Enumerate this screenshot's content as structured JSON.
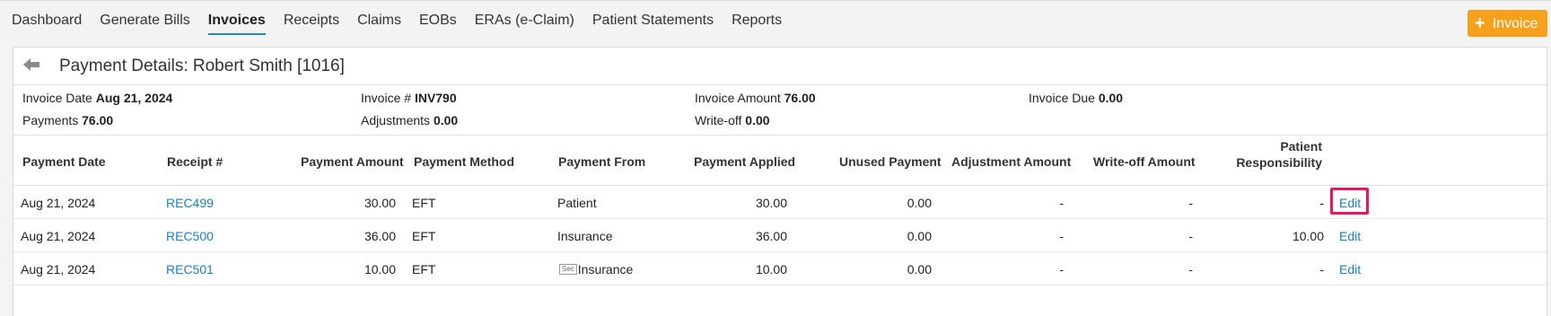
{
  "nav": {
    "items": [
      "Dashboard",
      "Generate Bills",
      "Invoices",
      "Receipts",
      "Claims",
      "EOBs",
      "ERAs (e-Claim)",
      "Patient Statements",
      "Reports"
    ],
    "active": "Invoices"
  },
  "add_invoice_button": {
    "label": "Invoice",
    "icon": "plus-icon",
    "color": "#f7a01c"
  },
  "page": {
    "title": "Payment Details: Robert Smith [1016]"
  },
  "summary": {
    "invoice_date_label": "Invoice Date",
    "invoice_date": "Aug 21, 2024",
    "invoice_no_label": "Invoice #",
    "invoice_no": "INV790",
    "invoice_amount_label": "Invoice Amount",
    "invoice_amount": "76.00",
    "invoice_due_label": "Invoice Due",
    "invoice_due": "0.00",
    "payments_label": "Payments",
    "payments": "76.00",
    "adjustments_label": "Adjustments",
    "adjustments": "0.00",
    "writeoff_label": "Write-off",
    "writeoff": "0.00"
  },
  "table": {
    "headers": {
      "payment_date": "Payment Date",
      "receipt_no": "Receipt #",
      "payment_amount": "Payment Amount",
      "payment_method": "Payment Method",
      "payment_from": "Payment From",
      "payment_applied": "Payment Applied",
      "unused_payment": "Unused Payment",
      "adjustment_amount": "Adjustment Amount",
      "writeoff_amount": "Write-off Amount",
      "patient_responsibility_1": "Patient",
      "patient_responsibility_2": "Responsibility"
    },
    "rows": [
      {
        "date": "Aug 21, 2024",
        "receipt": "REC499",
        "amount": "30.00",
        "method": "EFT",
        "from_badge": "",
        "from": "Patient",
        "applied": "30.00",
        "unused": "0.00",
        "adjustment": "-",
        "writeoff": "-",
        "responsibility": "-",
        "action": "Edit"
      },
      {
        "date": "Aug 21, 2024",
        "receipt": "REC500",
        "amount": "36.00",
        "method": "EFT",
        "from_badge": "",
        "from": "Insurance",
        "applied": "36.00",
        "unused": "0.00",
        "adjustment": "-",
        "writeoff": "-",
        "responsibility": "10.00",
        "action": "Edit"
      },
      {
        "date": "Aug 21, 2024",
        "receipt": "REC501",
        "amount": "10.00",
        "method": "EFT",
        "from_badge": "Sec",
        "from": "Insurance",
        "applied": "10.00",
        "unused": "0.00",
        "adjustment": "-",
        "writeoff": "-",
        "responsibility": "-",
        "action": "Edit"
      }
    ]
  },
  "colors": {
    "link": "#1a7fc0",
    "highlight": "#e8175d",
    "accent": "#1a87c9"
  }
}
